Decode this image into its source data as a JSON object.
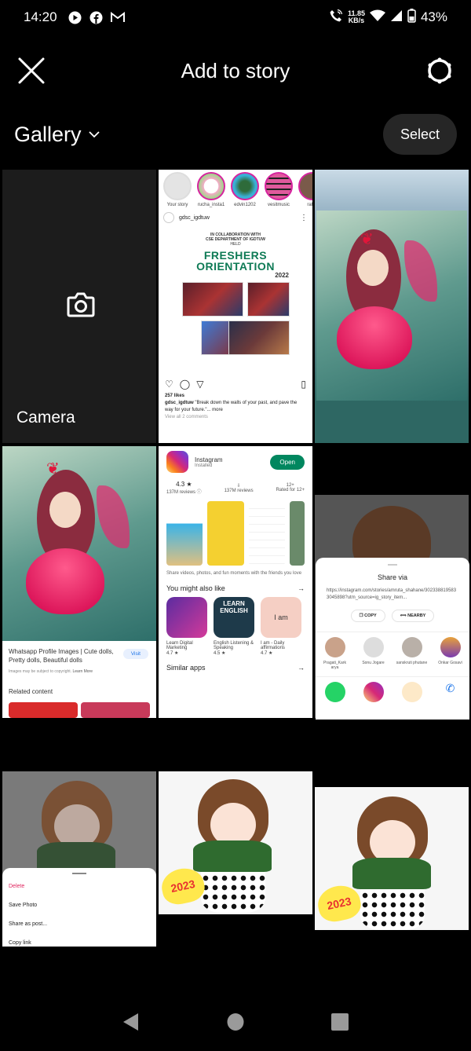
{
  "status_bar": {
    "time": "14:20",
    "notification_icons": [
      "youtube-icon",
      "facebook-icon",
      "gmail-icon"
    ],
    "net_speed_value": "11.85",
    "net_speed_unit": "KB/s",
    "battery": "43%"
  },
  "header": {
    "title": "Add to story",
    "close_icon": "close-icon",
    "settings_icon": "settings-icon"
  },
  "gallery": {
    "label": "Gallery",
    "select_label": "Select"
  },
  "grid": {
    "camera_label": "Camera",
    "ig_post": {
      "stories": [
        "Your story",
        "rucha_insta1",
        "edvin1202",
        "vesitmusic",
        "rahul"
      ],
      "username": "gdsc_igdtuw",
      "poster_lines": [
        "IN COLLABORATION WITH",
        "CSE DEPARTMENT OF IGDTUW",
        "HELD"
      ],
      "poster_title_1": "FRESHERS",
      "poster_title_2": "ORIENTATION",
      "poster_year": "2022",
      "likes": "257 likes",
      "caption_user": "gdsc_igdtuw",
      "caption": "\"Break down the walls of your past, and pave the way for your future.\"... more",
      "comments": "View all 2 comments"
    },
    "search_result": {
      "title": "Whatsapp Profile Images | Cute dolls, Pretty dolls, Beautiful dolls",
      "visit": "Visit",
      "copyright": "Images may be subject to copyright.",
      "learn_more": "Learn More",
      "related": "Related content"
    },
    "play_store": {
      "app_name": "Instagram",
      "installed": "Installed",
      "open_label": "Open",
      "rating": "4.3 ★",
      "reviews": "137M reviews ⓘ",
      "downloads": "137M reviews",
      "rated": "Rated for 12+",
      "description": "Share videos, photos, and fun moments with the friends you love",
      "you_might_like": "You might also like",
      "similar": "Similar apps",
      "apps": [
        {
          "name": "Learn Digital Marketing",
          "rating": "4.7 ★"
        },
        {
          "name": "English Listening & Speaking",
          "rating": "4.5 ★"
        },
        {
          "name": "I am - Daily affirmations",
          "rating": "4.7 ★"
        }
      ],
      "iam_tile": "I am"
    },
    "share_sheet": {
      "title": "Share via",
      "link": "https://instagram.com/stories/amruta_shahane/3023388195833045898?utm_source=ig_story_item...",
      "copy": "COPY",
      "nearby": "NEARBY",
      "contacts": [
        "Pragati_Kark arya",
        "Sonu Jogare",
        "sanskruti phutane",
        "Onkar Gosavi"
      ]
    },
    "action_sheet": {
      "items": [
        "Delete",
        "Save Photo",
        "Share as post...",
        "Copy link"
      ]
    },
    "sticker_text": "2023"
  },
  "nav": {
    "back": "back-icon",
    "home": "home-icon",
    "recents": "recents-icon"
  },
  "colors": {
    "background": "#000000",
    "select_bg": "#262626",
    "camera_tile": "#1c1c1c",
    "danger": "#e0245e",
    "play_green": "#01875f"
  }
}
